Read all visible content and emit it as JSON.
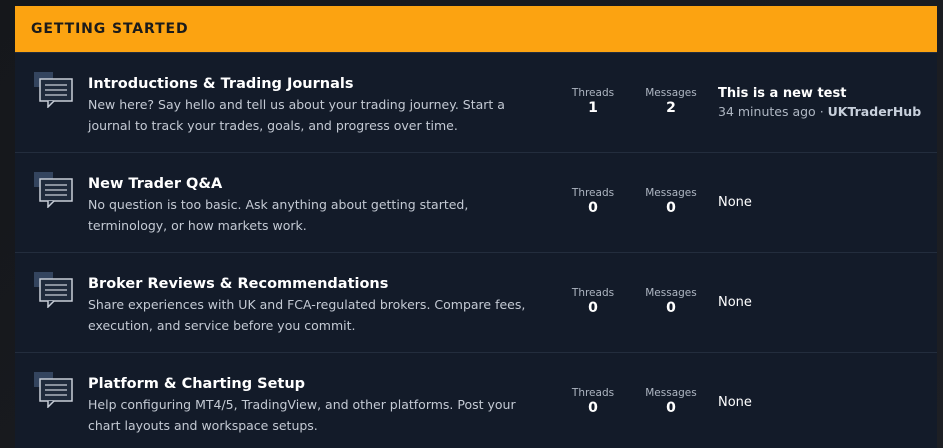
{
  "category": {
    "title": "GETTING STARTED"
  },
  "colors": {
    "accent": "#fca311",
    "panel": "#131b29",
    "divider": "#232d3d"
  },
  "forums": [
    {
      "icon": "forum-chat-icon",
      "title": "Introductions & Trading Journals",
      "description": "New here? Say hello and tell us about your trading journey. Start a journal to track your trades, goals, and progress over time.",
      "threads_label": "Threads",
      "threads": "1",
      "messages_label": "Messages",
      "messages": "2",
      "last_post": {
        "title": "This is a new test",
        "time": "34 minutes ago",
        "separator": "·",
        "user": "UKTraderHub"
      }
    },
    {
      "icon": "forum-chat-icon",
      "title": "New Trader Q&A",
      "description": "No question is too basic. Ask anything about getting started, terminology, or how markets work.",
      "threads_label": "Threads",
      "threads": "0",
      "messages_label": "Messages",
      "messages": "0",
      "last_post_text": "None"
    },
    {
      "icon": "forum-chat-icon",
      "title": "Broker Reviews & Recommendations",
      "description": "Share experiences with UK and FCA-regulated brokers. Compare fees, execution, and service before you commit.",
      "threads_label": "Threads",
      "threads": "0",
      "messages_label": "Messages",
      "messages": "0",
      "last_post_text": "None"
    },
    {
      "icon": "forum-chat-icon",
      "title": "Platform & Charting Setup",
      "description": "Help configuring MT4/5, TradingView, and other platforms. Post your chart layouts and workspace setups.",
      "threads_label": "Threads",
      "threads": "0",
      "messages_label": "Messages",
      "messages": "0",
      "last_post_text": "None"
    }
  ]
}
